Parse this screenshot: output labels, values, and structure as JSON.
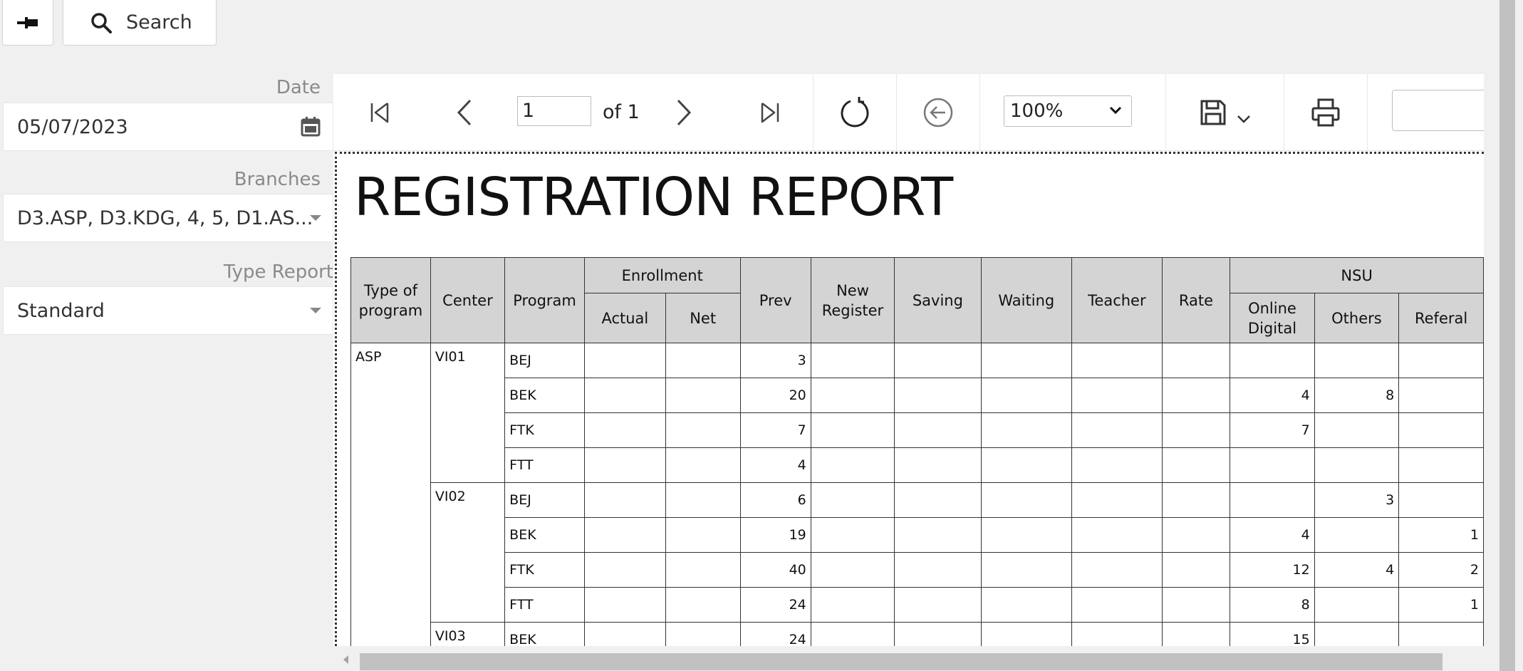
{
  "topbar": {
    "search_label": "Search"
  },
  "filters": {
    "date_label": "Date",
    "date_value": "05/07/2023",
    "branches_label": "Branches",
    "branches_value": "D3.ASP, D3.KDG, 4, 5, D1.AS...",
    "type_label": "Type Report",
    "type_value": "Standard"
  },
  "viewer": {
    "page_value": "1",
    "of_label": "of 1",
    "zoom_value": "100%"
  },
  "report": {
    "title": "REGISTRATION REPORT",
    "headers": {
      "type_of_program": "Type of program",
      "center": "Center",
      "program": "Program",
      "enrollment": "Enrollment",
      "actual": "Actual",
      "net": "Net",
      "prev": "Prev",
      "new_register": "New Register",
      "saving": "Saving",
      "waiting": "Waiting",
      "teacher": "Teacher",
      "rate": "Rate",
      "nsu": "NSU",
      "online_digital": "Online Digital",
      "others": "Others",
      "referal": "Referal"
    },
    "type_of_program": "ASP",
    "centers": [
      {
        "name": "VI01",
        "rows": [
          {
            "program": "BEJ",
            "prev": "3",
            "online": "",
            "others": "",
            "referal": ""
          },
          {
            "program": "BEK",
            "prev": "20",
            "online": "4",
            "others": "8",
            "referal": ""
          },
          {
            "program": "FTK",
            "prev": "7",
            "online": "7",
            "others": "",
            "referal": ""
          },
          {
            "program": "FTT",
            "prev": "4",
            "online": "",
            "others": "",
            "referal": ""
          }
        ]
      },
      {
        "name": "VI02",
        "rows": [
          {
            "program": "BEJ",
            "prev": "6",
            "online": "",
            "others": "3",
            "referal": ""
          },
          {
            "program": "BEK",
            "prev": "19",
            "online": "4",
            "others": "",
            "referal": "1"
          },
          {
            "program": "FTK",
            "prev": "40",
            "online": "12",
            "others": "4",
            "referal": "2"
          },
          {
            "program": "FTT",
            "prev": "24",
            "online": "8",
            "others": "",
            "referal": "1"
          }
        ]
      },
      {
        "name": "VI03",
        "rows": [
          {
            "program": "BEK",
            "prev": "24",
            "online": "15",
            "others": "",
            "referal": ""
          }
        ]
      }
    ]
  },
  "icons": {
    "pin": "pin-icon",
    "search": "search-icon",
    "calendar": "calendar-icon",
    "first_page": "first-page-icon",
    "prev_page": "prev-page-icon",
    "next_page": "next-page-icon",
    "last_page": "last-page-icon",
    "refresh": "refresh-icon",
    "back": "back-icon",
    "save": "save-icon",
    "print": "print-icon"
  }
}
